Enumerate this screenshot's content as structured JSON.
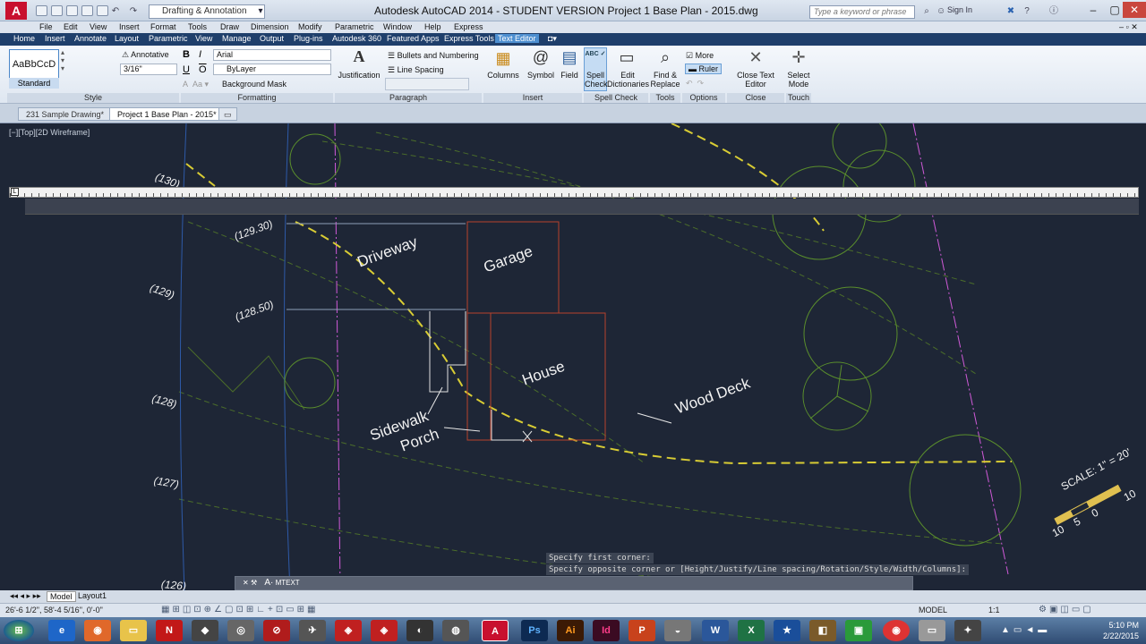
{
  "titlebar": {
    "logo_letter": "A",
    "workspace": "Drafting & Annotation",
    "title": "Autodesk AutoCAD 2014 - STUDENT VERSION     Project 1 Base Plan - 2015.dwg",
    "search_placeholder": "Type a keyword or phrase",
    "sign_in": "Sign In"
  },
  "menubar": [
    "File",
    "Edit",
    "View",
    "Insert",
    "Format",
    "Tools",
    "Draw",
    "Dimension",
    "Modify",
    "Parametric",
    "Window",
    "Help",
    "Express"
  ],
  "ribbon_tabs": [
    "Home",
    "Insert",
    "Annotate",
    "Layout",
    "Parametric",
    "View",
    "Manage",
    "Output",
    "Plug-ins",
    "Autodesk 360",
    "Featured Apps",
    "Express Tools",
    "Text Editor"
  ],
  "ribbon": {
    "style": {
      "preview": "AaBbCcD",
      "name": "Standard",
      "annotative": "Annotative",
      "height": "3/16\"",
      "panel": "Style"
    },
    "formatting": {
      "font": "Arial",
      "color": "ByLayer",
      "bold": "B",
      "italic": "I",
      "underline": "U",
      "overline": "O",
      "bg_mask": "Background Mask",
      "panel": "Formatting"
    },
    "paragraph": {
      "justification": "Justification",
      "bullets": "Bullets and Numbering",
      "line_spacing": "Line Spacing",
      "panel": "Paragraph"
    },
    "insert": {
      "columns": "Columns",
      "symbol": "Symbol",
      "field": "Field",
      "panel": "Insert"
    },
    "spell": {
      "spell_check": "Spell Check",
      "edit_dict": "Edit Dictionaries",
      "panel": "Spell Check"
    },
    "tools": {
      "find_replace": "Find & Replace",
      "panel": "Tools"
    },
    "options": {
      "more": "More",
      "ruler": "Ruler",
      "panel": "Options"
    },
    "close": {
      "close_editor": "Close Text Editor",
      "panel": "Close"
    },
    "touch": {
      "select_mode": "Select Mode",
      "panel": "Touch"
    }
  },
  "file_tabs": [
    "231 Sample Drawing*",
    "Project 1 Base Plan - 2015*"
  ],
  "drawing": {
    "view_label": "[−][Top][2D Wireframe]",
    "labels": {
      "driveway": "Driveway",
      "garage": "Garage",
      "house": "House",
      "wood_deck": "Wood Deck",
      "sidewalk": "Sidewalk",
      "porch": "Porch"
    },
    "elevations": [
      "(130)",
      "(129.30)",
      "(129)",
      "(128.50)",
      "(128)",
      "(127)",
      "(126)"
    ],
    "scale": {
      "text": "SCALE: 1\" = 20'",
      "marks": [
        "10",
        "5",
        "0",
        "10"
      ]
    },
    "command_history": [
      "Specify first corner:",
      "Specify opposite corner or [Height/Justify/Line spacing/Rotation/Style/Width/Columns]:"
    ],
    "command_prompt": "MTEXT"
  },
  "layout_tabs": [
    "Model",
    "Layout1"
  ],
  "status": {
    "coords": "26'-6 1/2\", 58'-4 5/16\", 0'-0\"",
    "model": "MODEL",
    "scale": "1:1"
  },
  "taskbar": {
    "apps": [
      "Ps",
      "Ai",
      "Id",
      "P",
      "W",
      "X"
    ],
    "time": "5:10 PM",
    "date": "2/22/2015"
  },
  "colors": {
    "accent": "#4d8fd0",
    "drawing_bg": "#1e2636",
    "magenta_line": "#d05ad8",
    "yellow_dash": "#d8cc34",
    "red_line": "#b8412c",
    "green_circle": "#5a8e2c"
  }
}
